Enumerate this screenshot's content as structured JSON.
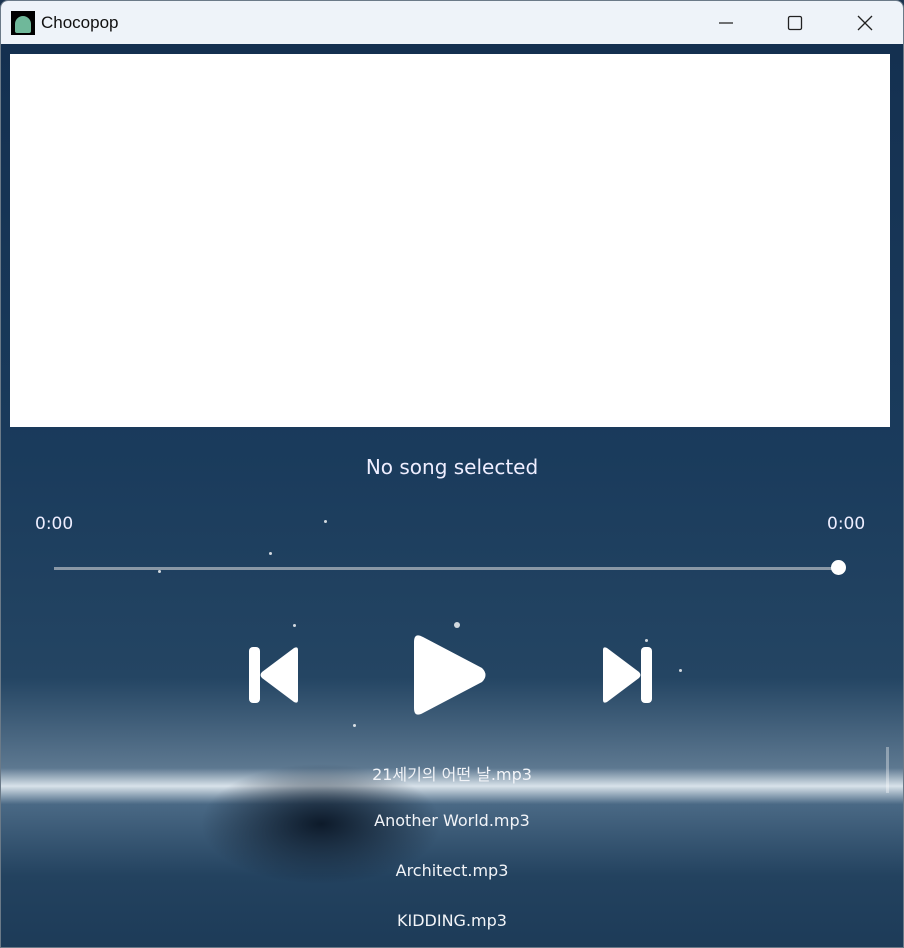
{
  "window": {
    "title": "Chocopop",
    "minimize_icon": "minimize-icon",
    "maximize_icon": "maximize-icon",
    "close_icon": "close-icon"
  },
  "player": {
    "song_title": "No song selected",
    "elapsed": "0:00",
    "duration": "0:00",
    "progress": 1.0
  },
  "controls": {
    "previous_icon": "skip-previous-icon",
    "play_icon": "play-icon",
    "next_icon": "skip-next-icon"
  },
  "playlist": [
    "21세기의 어떤 날.mp3",
    "Another World.mp3",
    "Architect.mp3",
    "KIDDING.mp3"
  ]
}
